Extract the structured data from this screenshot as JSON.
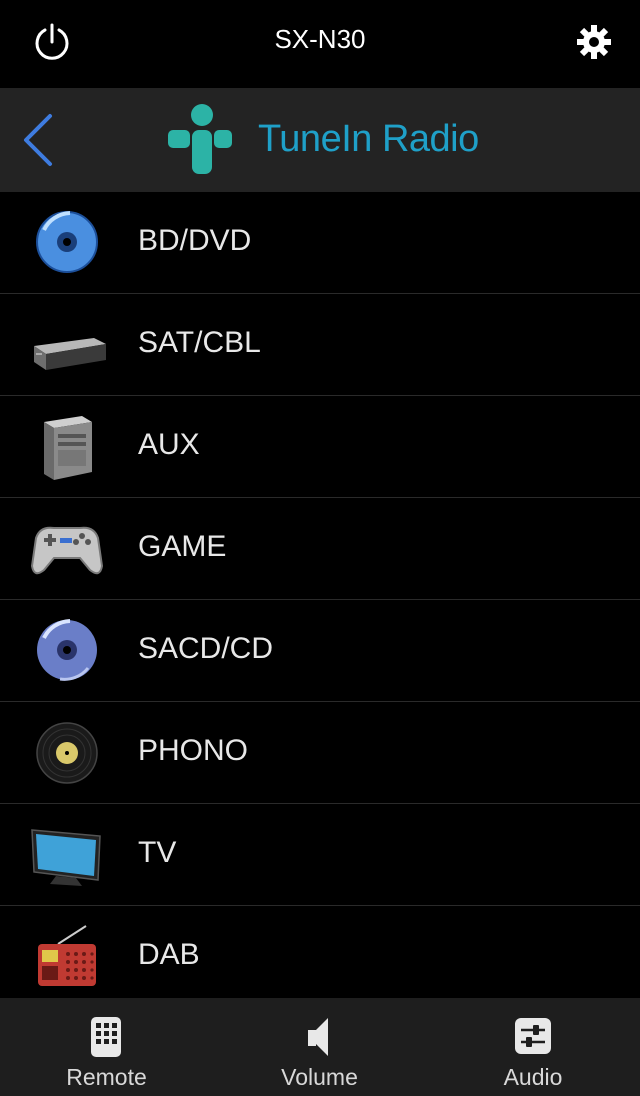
{
  "header": {
    "device_name": "SX-N30"
  },
  "source_bar": {
    "title": "TuneIn Radio"
  },
  "inputs": [
    {
      "label": "BD/DVD",
      "icon": "disc-blue-icon"
    },
    {
      "label": "SAT/CBL",
      "icon": "settop-box-icon"
    },
    {
      "label": "AUX",
      "icon": "computer-tower-icon"
    },
    {
      "label": "GAME",
      "icon": "gamepad-icon"
    },
    {
      "label": "SACD/CD",
      "icon": "disc-cd-icon"
    },
    {
      "label": "PHONO",
      "icon": "vinyl-record-icon"
    },
    {
      "label": "TV",
      "icon": "tv-icon"
    },
    {
      "label": "DAB",
      "icon": "radio-icon"
    }
  ],
  "tabs": [
    {
      "label": "Remote",
      "icon": "keypad-icon"
    },
    {
      "label": "Volume",
      "icon": "speaker-icon"
    },
    {
      "label": "Audio",
      "icon": "sliders-icon"
    }
  ],
  "colors": {
    "accent": "#1fa0c8",
    "back": "#3e7ce0",
    "logo": "#2cb3a6"
  }
}
